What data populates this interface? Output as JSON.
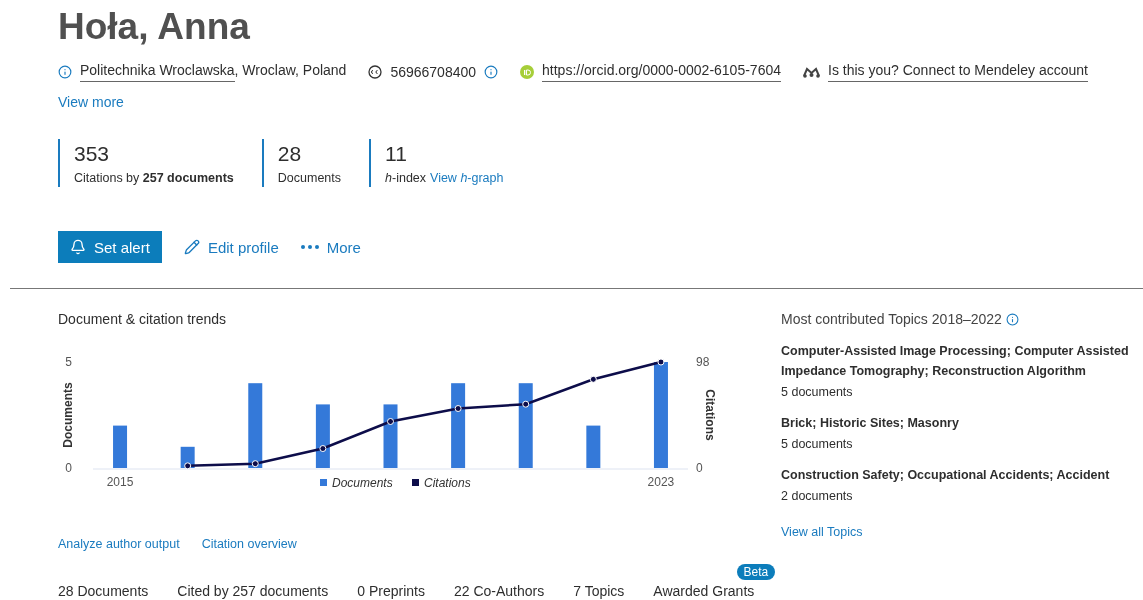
{
  "author": {
    "name": "Hoła, Anna"
  },
  "details": [
    {
      "kind": "affiliation",
      "link": "Politechnika Wroclawska",
      "text": ", Wroclaw, Poland"
    },
    {
      "kind": "scopus",
      "text": "56966708400"
    },
    {
      "kind": "orcid",
      "link": "https://orcid.org/0000-0002-6105-7604"
    },
    {
      "kind": "mendeley",
      "link": "Is this you? Connect to Mendeley account"
    }
  ],
  "view_more": "View more",
  "metrics": [
    {
      "value": "353",
      "label": "Citations by **257 documents**"
    },
    {
      "value": "28",
      "label": "Documents"
    },
    {
      "value": "11",
      "label": "*h*-index",
      "link": "View *h*-graph"
    }
  ],
  "actions": [
    {
      "kind": "primary",
      "label": "Set alert"
    },
    {
      "kind": "edit",
      "label": "Edit profile"
    },
    {
      "kind": "more",
      "label": "More"
    }
  ],
  "trends": {
    "title": "Document & citation trends",
    "chart_data": {
      "type": "bar",
      "x": [
        2015,
        2016,
        2017,
        2018,
        2019,
        2020,
        2021,
        2022,
        2023
      ],
      "series": [
        {
          "name": "Documents",
          "type": "bar",
          "color": "#3479d9",
          "values": [
            2,
            1,
            4,
            3,
            3,
            4,
            4,
            2,
            5
          ]
        },
        {
          "name": "Citations",
          "type": "line",
          "axis": "y2",
          "marker": "o",
          "color": "#0d0d4a",
          "values": [
            null,
            2,
            4,
            18,
            43,
            55,
            59,
            82,
            98
          ]
        }
      ],
      "ylabel": "Documents",
      "y2label": "Citations",
      "ylim": [
        0,
        5
      ],
      "y2lim": [
        0,
        98
      ],
      "yticks": [
        0,
        5
      ],
      "y2ticks": [
        0,
        98
      ],
      "xlim": [
        2014.6,
        2023.4
      ],
      "xticks": [
        2015,
        2023
      ],
      "legend": "bottom"
    },
    "links": [
      "Analyze author output",
      "Citation overview"
    ]
  },
  "topics": {
    "title": "Most contributed Topics",
    "years": "2018–2022",
    "items": [
      {
        "name": "Computer-Assisted Image Processing; Computer Assisted Impedance Tomography; Reconstruction Algorithm",
        "count": "5 documents"
      },
      {
        "name": "Brick; Historic Sites; Masonry",
        "count": "5 documents"
      },
      {
        "name": "Construction Safety; Occupational Accidents; Accident",
        "count": "2 documents"
      }
    ],
    "link": "View all Topics"
  },
  "tabs": [
    {
      "label": "28 Documents"
    },
    {
      "label": "Cited by 257 documents"
    },
    {
      "label": "0 Preprints"
    },
    {
      "label": "22 Co-Authors"
    },
    {
      "label": "7 Topics"
    },
    {
      "label": "Awarded Grants",
      "badge": "Beta"
    }
  ]
}
